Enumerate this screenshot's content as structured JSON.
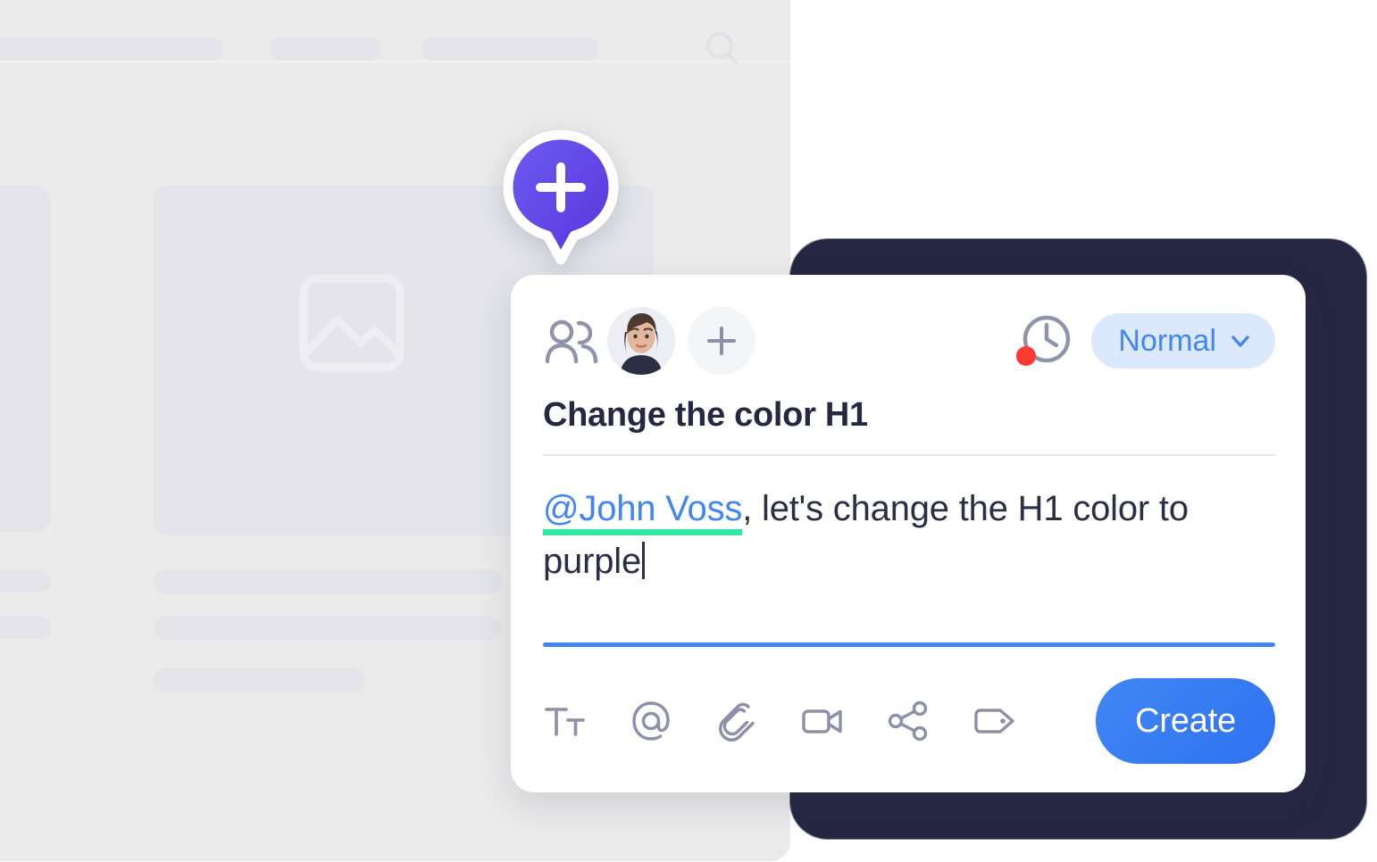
{
  "background_app": {
    "name": "skeleton-app-window",
    "topbar_tabs": [
      "",
      "",
      "",
      ""
    ],
    "search_icon": "search-icon",
    "image_placeholder_icon": "image-placeholder-icon",
    "colors": {
      "window_bg": "#ebebeb",
      "placeholder": "#e4e4ea"
    }
  },
  "pin_marker": {
    "icon": "plus-pin-icon",
    "gradient_from": "#6c5ce7",
    "gradient_to": "#5b3fe0"
  },
  "card": {
    "header": {
      "people_icon": "people-icon",
      "avatar": "avatar",
      "add_person_icon": "plus-icon",
      "reminder_icon": "clock-icon",
      "reminder_badge_color": "#fa3b34",
      "priority": {
        "label": "Normal",
        "chevron_icon": "chevron-down-icon",
        "bg_color": "#dce9fd",
        "text_color": "#4285f4"
      }
    },
    "title": "Change the color H1",
    "body": {
      "mention": "@John Voss",
      "mention_color": "#4285f4",
      "mention_underline_color": "#2ee8a5",
      "rest": ", let's change the H1 color to purple",
      "caret_visible": true
    },
    "input_rule_color": "#4285f4",
    "toolbar": {
      "items": [
        {
          "icon": "text-format-icon",
          "label": "Text formatting"
        },
        {
          "icon": "at-mention-icon",
          "label": "Mention"
        },
        {
          "icon": "paperclip-icon",
          "label": "Attach file"
        },
        {
          "icon": "video-camera-icon",
          "label": "Record video"
        },
        {
          "icon": "share-icon",
          "label": "Share"
        },
        {
          "icon": "tag-icon",
          "label": "Add tag"
        }
      ],
      "create_label": "Create",
      "create_color": "#2f72f0"
    },
    "backdrop_color": "#262843"
  }
}
